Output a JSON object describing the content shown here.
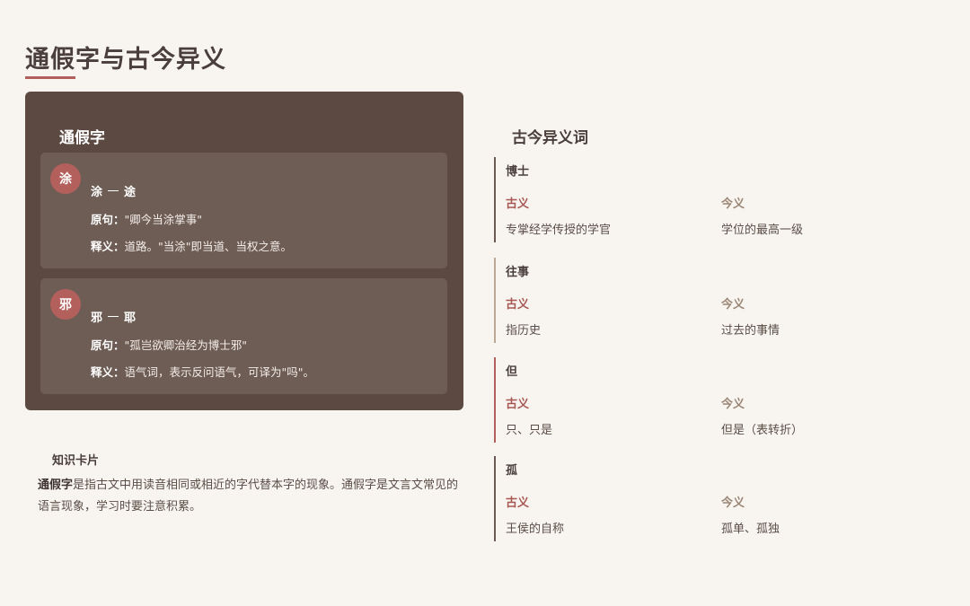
{
  "page": {
    "title": "通假字与古今异义"
  },
  "tongjia": {
    "title": "通假字",
    "label_original": "原句：",
    "label_meaning": "释义：",
    "cards": [
      {
        "badge": "涂",
        "from": "涂",
        "to": "途",
        "original": "\"卿今当涂掌事\"",
        "meaning": "道路。\"当涂\"即当道、当权之意。"
      },
      {
        "badge": "邪",
        "from": "邪",
        "to": "耶",
        "original": "\"孤岂欲卿治经为博士邪\"",
        "meaning": "语气词，表示反问语气，可译为\"吗\"。"
      }
    ]
  },
  "knowledge": {
    "title": "知识卡片",
    "bold": "通假字",
    "text": "是指古文中用读音相同或相近的字代替本字的现象。通假字是文言文常见的语言现象，学习时要注意积累。"
  },
  "gujin": {
    "title": "古今异义词",
    "old_label": "古义",
    "new_label": "今义",
    "words": [
      {
        "word": "博士",
        "old": "专掌经学传授的学官",
        "new": "学位的最高一级"
      },
      {
        "word": "往事",
        "old": "指历史",
        "new": "过去的事情"
      },
      {
        "word": "但",
        "old": "只、只是",
        "new": "但是（表转折）"
      },
      {
        "word": "孤",
        "old": "王侯的自称",
        "new": "孤单、孤独"
      }
    ]
  },
  "colors": {
    "accent": "#b3605d",
    "panel": "#5c4a42",
    "card": "#6e5d55",
    "background": "#f8f5f1"
  }
}
